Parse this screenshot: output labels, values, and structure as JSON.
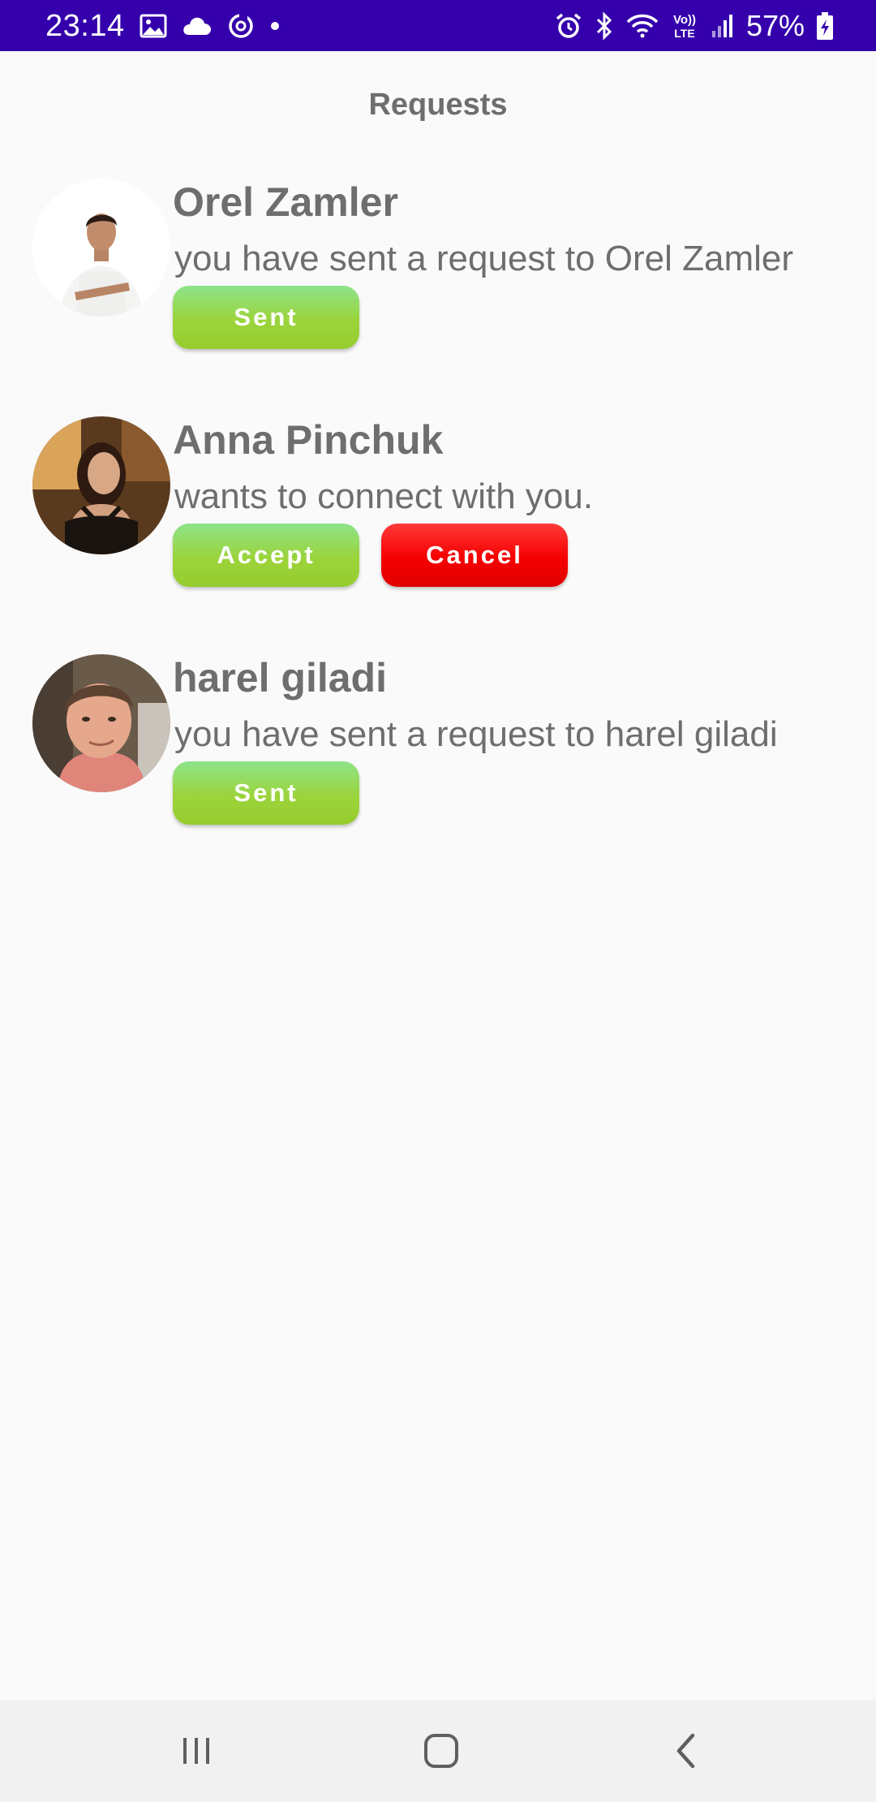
{
  "status_bar": {
    "time": "23:14",
    "battery_percent": "57%",
    "left_icons": [
      "image-icon",
      "cloud-icon",
      "sync-icon",
      "dot-icon"
    ],
    "right_icons": [
      "alarm-icon",
      "bluetooth-icon",
      "wifi-icon",
      "volte-icon",
      "signal-icon",
      "battery-icon"
    ],
    "volte_label_top": "Vo))",
    "volte_label_bottom": "LTE",
    "background_color": "#3500ac"
  },
  "header": {
    "title": "Requests"
  },
  "requests": [
    {
      "name": "Orel Zamler",
      "message": "you have sent a request to Orel Zamler",
      "buttons": [
        "Sent"
      ]
    },
    {
      "name": "Anna Pinchuk",
      "message": "wants to connect with you.",
      "buttons": [
        "Accept",
        "Cancel"
      ]
    },
    {
      "name": "harel giladi",
      "message": "you have sent a request to harel giladi",
      "buttons": [
        "Sent"
      ]
    }
  ],
  "nav_bar": {
    "icons": [
      "recent-apps-icon",
      "home-icon",
      "back-icon"
    ]
  },
  "colors": {
    "accept_green": "#9bd43b",
    "cancel_red": "#f50000",
    "text_gray": "#6e6e6e",
    "background": "#fafafa",
    "nav_background": "#f1f1f1"
  }
}
